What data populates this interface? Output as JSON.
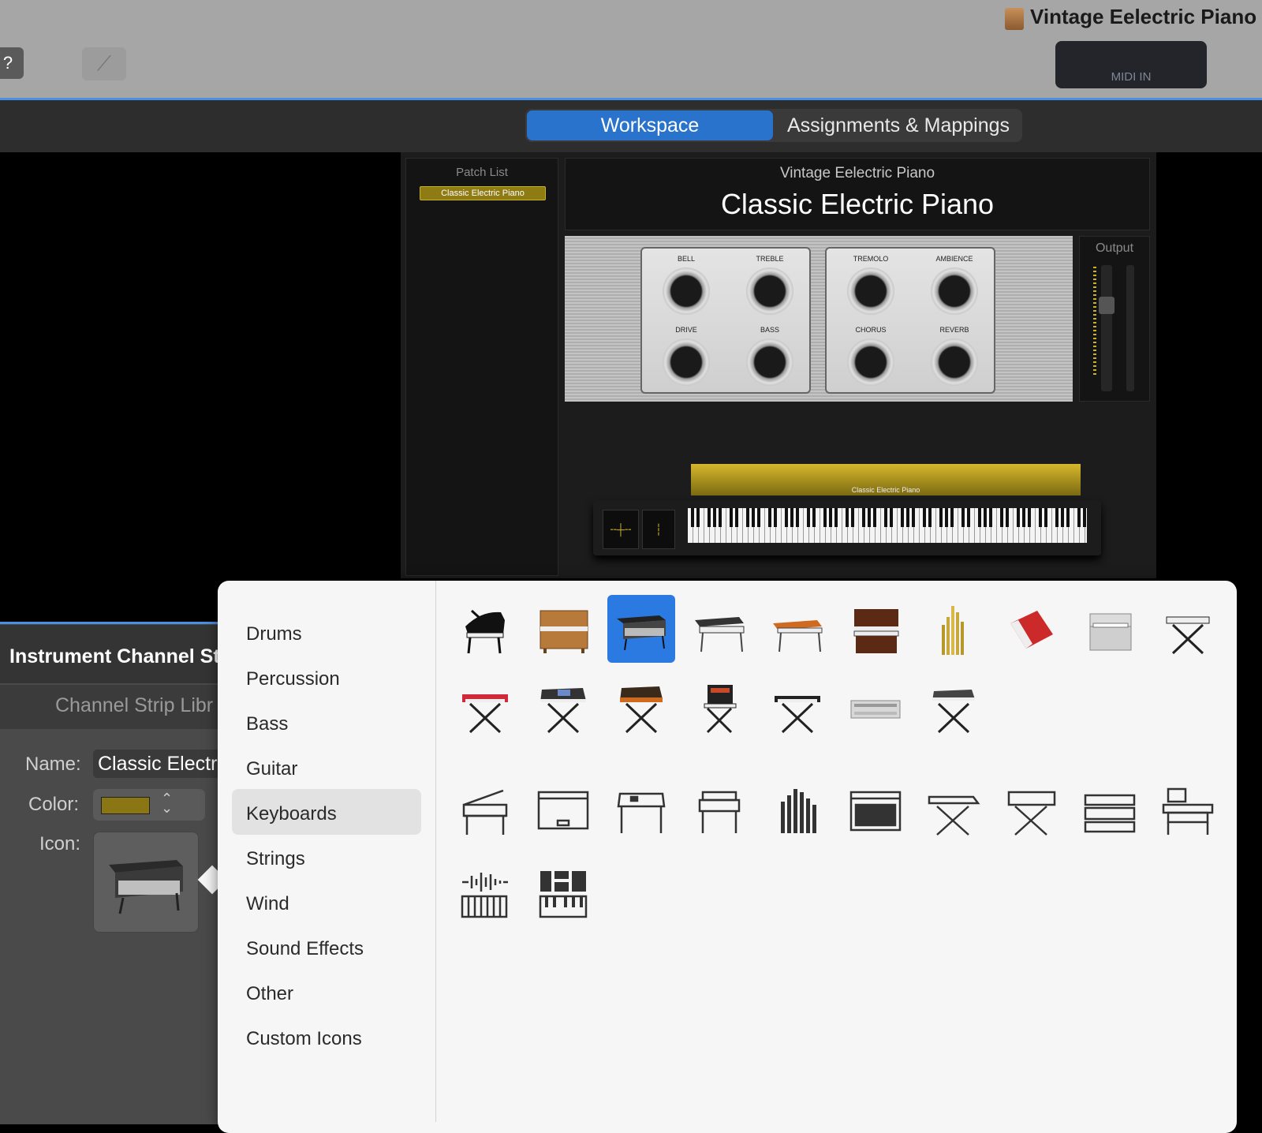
{
  "window": {
    "title": "Vintage Eelectric Piano",
    "midi_in_label": "MIDI IN",
    "help_icon": "question-mark-icon",
    "tool_icon": "tuning-fork-icon"
  },
  "tabs": [
    {
      "label": "Workspace",
      "selected": true
    },
    {
      "label": "Assignments & Mappings",
      "selected": false
    }
  ],
  "patch_list": {
    "title": "Patch List",
    "items": [
      "Classic Electric Piano"
    ]
  },
  "header": {
    "subtitle": "Vintage Eelectric Piano",
    "title": "Classic Electric Piano"
  },
  "plugin": {
    "knobs_left": [
      "BELL",
      "TREBLE",
      "DRIVE",
      "BASS"
    ],
    "knobs_right": [
      "TREMOLO",
      "AMBIENCE",
      "CHORUS",
      "REVERB"
    ]
  },
  "output": {
    "label": "Output"
  },
  "keyboard": {
    "label": "Classic Electric Piano"
  },
  "inspector": {
    "title": "Instrument Channel St",
    "library_label": "Channel Strip Libr",
    "name_label": "Name:",
    "name_value": "Classic Electr",
    "color_label": "Color:",
    "color_value": "#8a7714",
    "icon_label": "Icon:"
  },
  "icon_picker": {
    "categories": [
      "Drums",
      "Percussion",
      "Bass",
      "Guitar",
      "Keyboards",
      "Strings",
      "Wind",
      "Sound Effects",
      "Other",
      "Custom Icons"
    ],
    "selected_category": "Keyboards",
    "photo_icons": [
      "grand-piano-icon",
      "upright-piano-icon",
      "electric-piano-icon",
      "wurlitzer-piano-icon",
      "stage-piano-icon",
      "organ-icon",
      "pipe-organ-icon",
      "accordion-icon",
      "harmonium-icon",
      "keyboard-stand-icon",
      "red-synth-stand-icon",
      "workstation-synth-icon",
      "analog-synth-icon",
      "modular-synth-icon",
      "digital-synth-icon",
      "drum-machine-icon",
      "keytar-stand-icon"
    ],
    "selected_icon": "electric-piano-icon",
    "glyph_icons": [
      "grand-piano-glyph-icon",
      "upright-piano-glyph-icon",
      "electric-piano-glyph-icon",
      "organ-glyph-icon",
      "pipe-organ-glyph-icon",
      "amp-glyph-icon",
      "synth-stand-glyph-icon",
      "keyboard-stand-glyph-icon",
      "sequencer-glyph-icon",
      "computer-desk-glyph-icon",
      "waveform-keys-glyph-icon",
      "sampler-keys-glyph-icon"
    ]
  }
}
